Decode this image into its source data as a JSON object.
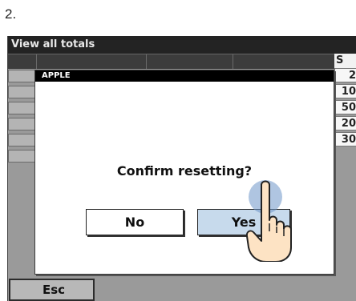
{
  "step": {
    "label": "2."
  },
  "app": {
    "title": "View all totals",
    "right_column": {
      "header": "S",
      "values": [
        "2",
        "10",
        "50",
        "20",
        "30"
      ]
    },
    "esc_label": "Esc"
  },
  "dialog": {
    "title": "APPLE",
    "message": "Confirm resetting?",
    "no_label": "No",
    "yes_label": "Yes"
  },
  "colors": {
    "title_bar": "#232323",
    "screen_bg": "#9a9a9a",
    "yes_button": "#c7daec",
    "touch_indicator": "#6e96c8"
  },
  "icons": {
    "hand": "pointing-hand-icon",
    "touch": "touch-indicator-icon"
  }
}
